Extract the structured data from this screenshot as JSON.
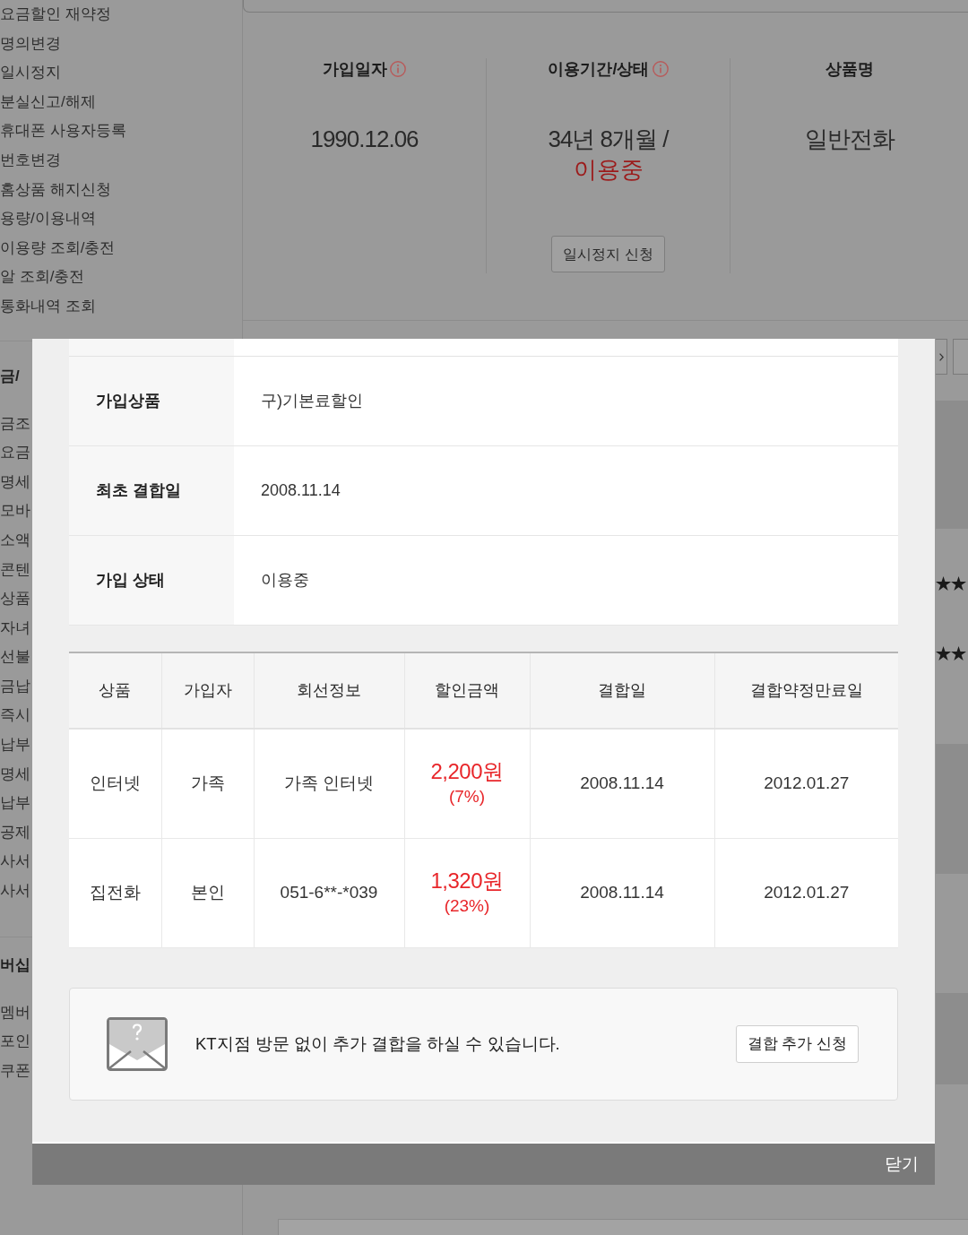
{
  "sidebar": {
    "menu_items": [
      "요금할인 재약정",
      "명의변경",
      "일시정지",
      "분실신고/해제",
      "휴대폰 사용자등록",
      "번호변경",
      "홈상품 해지신청",
      "용량/이용내역",
      "이용량 조회/충전",
      "알 조회/충전",
      "통화내역 조회"
    ],
    "sections": [
      {
        "title": "금/",
        "items": [
          "금조",
          "요금",
          "명세",
          "모바",
          "소액",
          "콘텐",
          "상품",
          "자녀",
          "선불",
          "금납",
          "즉시",
          "납부",
          "명세",
          "납부",
          "공제",
          "사서",
          "사서"
        ]
      },
      {
        "title": "버십",
        "items": [
          "멤버",
          "포인",
          "쿠폰"
        ]
      }
    ]
  },
  "summary": {
    "columns": [
      {
        "heading": "가입일자",
        "info_icon": true,
        "value": "1990.12.06"
      },
      {
        "heading": "이용기간/상태",
        "info_icon": true,
        "value": "34년 8개월 /",
        "status": "이용중",
        "button": "일시정지 신청"
      },
      {
        "heading": "상품명",
        "value": "일반전화"
      }
    ]
  },
  "background_table": {
    "masked_values": [
      "★★",
      "★★"
    ]
  },
  "modal": {
    "info_rows": [
      {
        "label": "가입상품",
        "value": "구)기본료할인"
      },
      {
        "label": "최초 결합일",
        "value": "2008.11.14"
      },
      {
        "label": "가입 상태",
        "value": "이용중"
      }
    ],
    "table": {
      "columns": [
        "상품",
        "가입자",
        "회선정보",
        "할인금액",
        "결합일",
        "결합약정만료일"
      ],
      "rows": [
        {
          "product": "인터넷",
          "subscriber": "가족",
          "line_info": "가족 인터넷",
          "discount": {
            "amount": "2,200원",
            "rate": "(7%)"
          },
          "combined_date": "2008.11.14",
          "contract_end": "2012.01.27"
        },
        {
          "product": "집전화",
          "subscriber": "본인",
          "line_info": "051-6**-*039",
          "discount": {
            "amount": "1,320원",
            "rate": "(23%)"
          },
          "combined_date": "2008.11.14",
          "contract_end": "2012.01.27"
        }
      ]
    },
    "notice": {
      "text": "KT지점 방문 없이 추가 결합을 하실 수 있습니다.",
      "button": "결합 추가 신청"
    },
    "close_button": "닫기"
  }
}
